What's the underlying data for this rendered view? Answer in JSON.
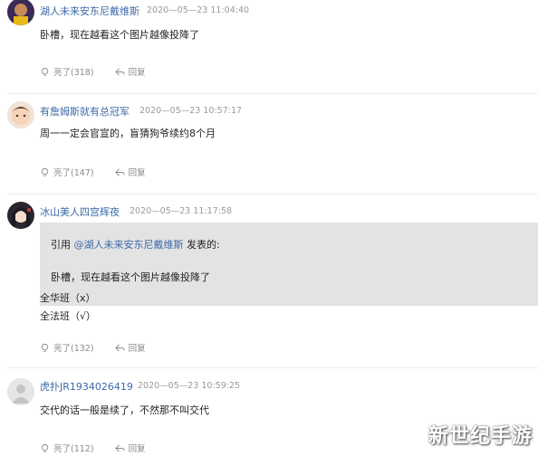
{
  "comments": [
    {
      "user": "湖人未来安东尼戴维斯",
      "time": "2020—05—23 11:04:40",
      "text": "卧槽，现在越看这个图片越像投降了",
      "likes": "亮了(318)",
      "reply": "回复"
    },
    {
      "user": "有詹姆斯就有总冠军",
      "time": "2020—05—23 10:57:17",
      "text": "周一一定会官宣的，盲猜狗爷续约8个月",
      "likes": "亮了(147)",
      "reply": "回复"
    },
    {
      "user": "冰山美人四宫辉夜",
      "time": "2020—05—23 11:17:58",
      "quote_prefix": "引用 ",
      "quote_ref": "@湖人未来安东尼戴维斯",
      "quote_suffix": " 发表的:",
      "quote_text": "卧槽，现在越看这个图片越像投降了",
      "line1": "全华班（x）",
      "line2": "全法班（√）",
      "likes": "亮了(132)",
      "reply": "回复"
    },
    {
      "user": "虎扑JR1934026419",
      "time": "2020—05—23 10:59:25",
      "text": "交代的话一般是续了，不然那不叫交代",
      "likes": "亮了(112)",
      "reply": "回复"
    }
  ],
  "watermark": "新世纪手游",
  "colors": {
    "username": "#3d6aa6",
    "quote_bg": "#e3e3e3",
    "meta": "#9a9a9a"
  }
}
